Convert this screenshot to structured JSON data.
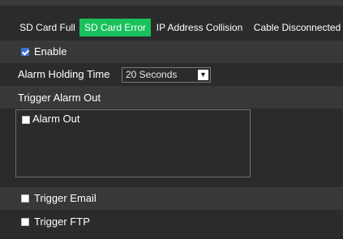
{
  "tabs": [
    {
      "label": "SD Card Full",
      "active": false
    },
    {
      "label": "SD Card Error",
      "active": true
    },
    {
      "label": "IP Address Collision",
      "active": false
    },
    {
      "label": "Cable Disconnected",
      "active": false
    }
  ],
  "enable": {
    "label": "Enable",
    "checked": true
  },
  "alarm_holding": {
    "label": "Alarm Holding Time",
    "value": "20 Seconds"
  },
  "trigger_alarm_out": {
    "label": "Trigger Alarm Out",
    "items": [
      {
        "label": "Alarm Out",
        "checked": false
      }
    ]
  },
  "trigger_email": {
    "label": "Trigger Email",
    "checked": false
  },
  "trigger_ftp": {
    "label": "Trigger FTP",
    "checked": false
  },
  "colors": {
    "accent": "#19c15c",
    "background": "#2b2b2b",
    "row_alt": "#383838",
    "checkbox_checked": "#3d6fd6"
  }
}
